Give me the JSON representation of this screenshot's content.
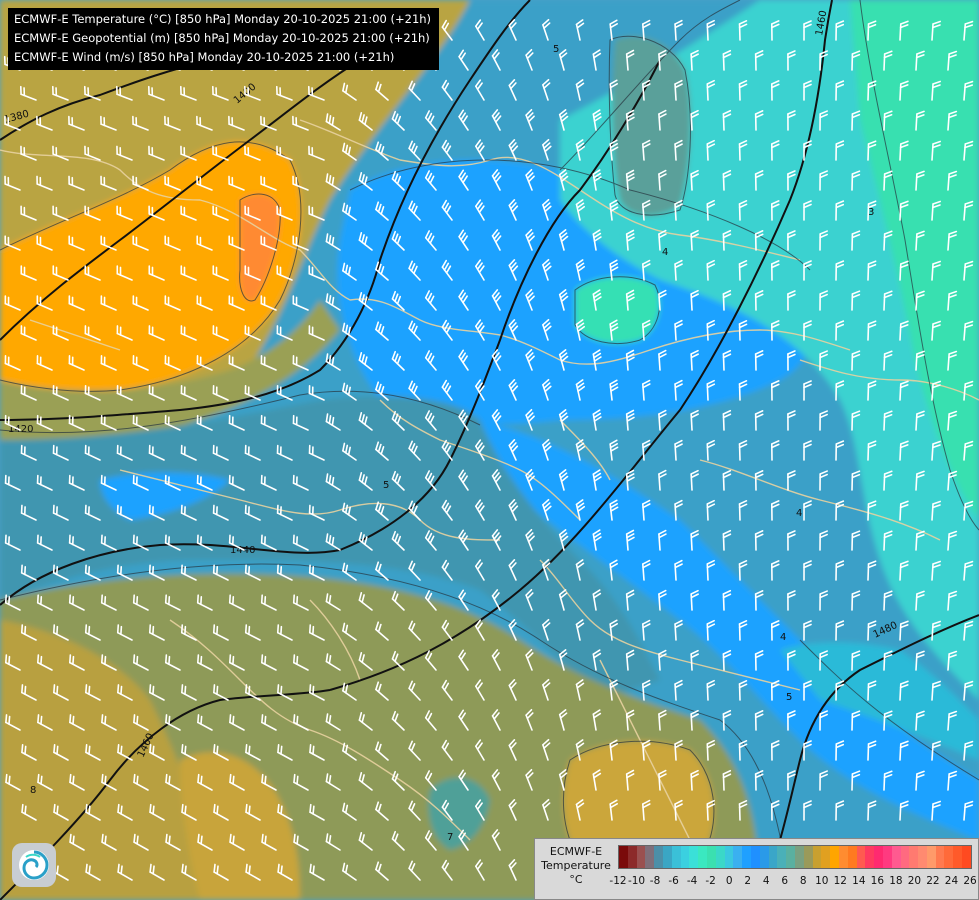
{
  "header": {
    "lines": [
      "ECMWF-E Temperature (°C) [850 hPa] Monday 20-10-2025 21:00 (+21h)",
      "ECMWF-E Geopotential (m) [850 hPa] Monday 20-10-2025 21:00 (+21h)",
      "ECMWF-E Wind (m/s) [850 hPa] Monday 20-10-2025 21:00 (+21h)"
    ]
  },
  "legend": {
    "title_line1": "ECMWF-E",
    "title_line2": "Temperature",
    "unit": "°C",
    "ticks": [
      "-12",
      "-10",
      "-8",
      "-6",
      "-4",
      "-2",
      "0",
      "2",
      "4",
      "6",
      "8",
      "10",
      "12",
      "14",
      "16",
      "18",
      "20",
      "22",
      "24",
      "26"
    ],
    "colors": [
      "#7a0a0a",
      "#8c2a2a",
      "#9a5050",
      "#7f6f7a",
      "#4c8fa8",
      "#3aa6c4",
      "#3ac0d8",
      "#3ad0e0",
      "#3ae0d8",
      "#3ae8c0",
      "#3ae0b0",
      "#3ad8c8",
      "#3ac8e0",
      "#3ab0f0",
      "#1fa0ff",
      "#1f90ff",
      "#2a9ae8",
      "#3aa6c8",
      "#4ab0b8",
      "#5ab0a0",
      "#7aa080",
      "#9a9a5a",
      "#c8a030",
      "#e0a020",
      "#ffa500",
      "#ff8c30",
      "#ff7a20",
      "#ff5a50",
      "#ff3a60",
      "#ff2a70",
      "#ff3a80",
      "#ff5a90",
      "#ff6a80",
      "#ff7a70",
      "#ff8a70",
      "#ff9a6a",
      "#ff7a50",
      "#ff6a3a",
      "#ff5a2a",
      "#ff4a20"
    ]
  },
  "contour_labels": {
    "geopotential": [
      "1380",
      "1400",
      "1420",
      "1440",
      "1460",
      "1460",
      "1480"
    ],
    "temperature": [
      "5",
      "4",
      "3",
      "4",
      "4",
      "5",
      "8",
      "7",
      "5"
    ]
  },
  "colors": {
    "warm_orange": "#ffa800",
    "hot_orange": "#ff8a30",
    "brown_olive": "#c8a43a",
    "olive": "#8a9a56",
    "teal": "#3f9aa8",
    "blue": "#1fa2ff",
    "cyan": "#3ad8c8",
    "mint": "#38e0b0"
  }
}
